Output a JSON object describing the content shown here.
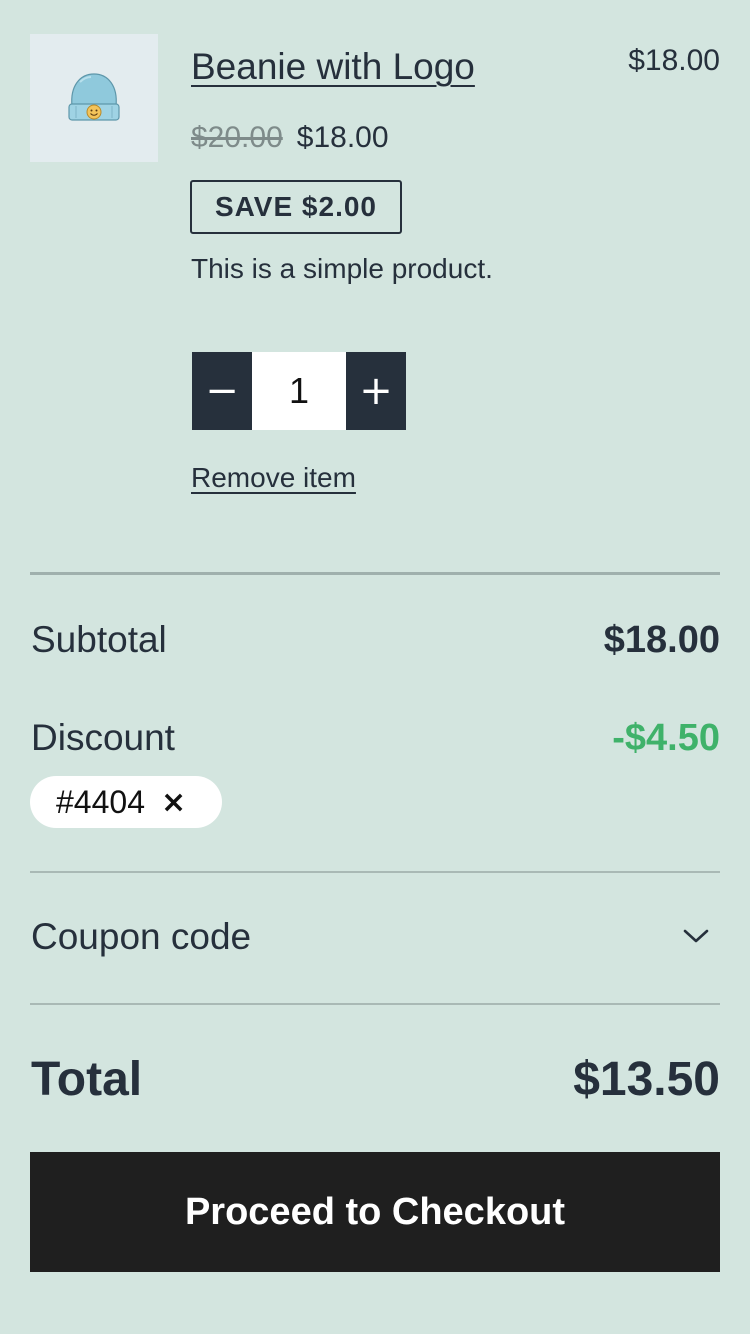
{
  "product": {
    "name": "Beanie with Logo",
    "line_total": "$18.00",
    "regular_price": "$20.00",
    "sale_price": "$18.00",
    "save_badge": "SAVE $2.00",
    "description": "This is a simple product.",
    "quantity": "1",
    "decrease_label": "−",
    "increase_label": "+",
    "remove_label": "Remove item",
    "image_icon": "beanie-icon"
  },
  "totals": {
    "subtotal_label": "Subtotal",
    "subtotal_value": "$18.00",
    "discount_label": "Discount",
    "discount_value": "-$4.50",
    "coupon_chip": "#4404",
    "coupon_remove": "×",
    "coupon_toggle_label": "Coupon code",
    "total_label": "Total",
    "total_value": "$13.50"
  },
  "checkout": {
    "button_label": "Proceed to Checkout"
  },
  "colors": {
    "background": "#d3e5df",
    "text": "#26303c",
    "discount": "#3fb26a",
    "button": "#1f1f1f"
  }
}
